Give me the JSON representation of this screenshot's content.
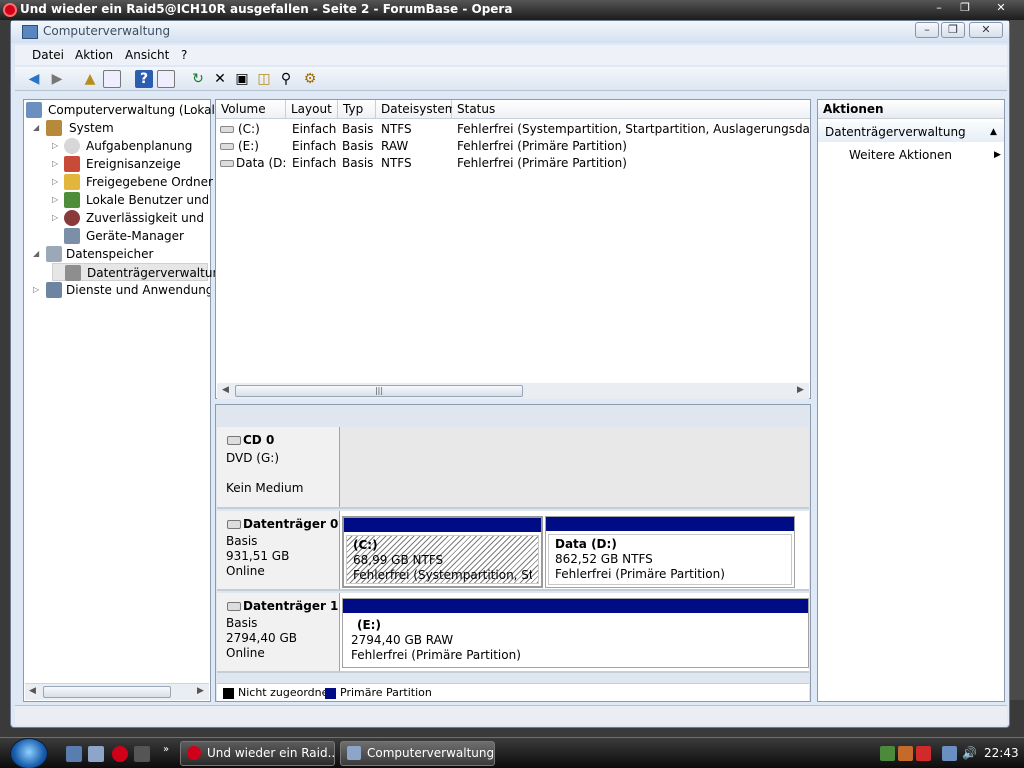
{
  "opera": {
    "title": "Und wieder ein Raid5@ICH10R ausgefallen - Seite 2 - ForumBase - Opera"
  },
  "mmc": {
    "title": "Computerverwaltung",
    "menu": [
      "Datei",
      "Aktion",
      "Ansicht",
      "?"
    ]
  },
  "tree": {
    "root": "Computerverwaltung (Lokal)",
    "system": "System",
    "items": [
      "Aufgabenplanung",
      "Ereignisanzeige",
      "Freigegebene Ordner",
      "Lokale Benutzer und Gruppen",
      "Zuverlässigkeit und Leistung",
      "Geräte-Manager"
    ],
    "storage": "Datenspeicher",
    "disk_mgmt": "Datenträgerverwaltung",
    "services": "Dienste und Anwendungen"
  },
  "list": {
    "columns": [
      "Volume",
      "Layout",
      "Typ",
      "Dateisystem",
      "Status"
    ],
    "rows": [
      [
        "(C:)",
        "Einfach",
        "Basis",
        "NTFS",
        "Fehlerfrei (Systempartition, Startpartition, Auslagerungsdatei, Aktiv, Absturzabbild, Primäre Partition)"
      ],
      [
        "(E:)",
        "Einfach",
        "Basis",
        "RAW",
        "Fehlerfrei (Primäre Partition)"
      ],
      [
        "Data (D:)",
        "Einfach",
        "Basis",
        "NTFS",
        "Fehlerfrei (Primäre Partition)"
      ]
    ]
  },
  "disks": {
    "cd0": {
      "name": "CD 0",
      "type": "DVD (G:)",
      "status": "Kein Medium"
    },
    "disk0": {
      "name": "Datenträger 0",
      "type": "Basis",
      "size": "931,51 GB",
      "state": "Online",
      "p1": {
        "label": "(C:)",
        "size": "68,99 GB NTFS",
        "status": "Fehlerfrei (Systempartition, Startpartition)"
      },
      "p2": {
        "label": "Data  (D:)",
        "size": "862,52 GB NTFS",
        "status": "Fehlerfrei (Primäre Partition)"
      }
    },
    "disk1": {
      "name": "Datenträger 1",
      "type": "Basis",
      "size": "2794,40 GB",
      "state": "Online",
      "p1": {
        "label": "(E:)",
        "size": "2794,40 GB RAW",
        "status": "Fehlerfrei (Primäre Partition)"
      }
    }
  },
  "legend": {
    "unallocated": "Nicht zugeordnet",
    "primary": "Primäre Partition",
    "unallocated_color": "#000000",
    "primary_color": "#000c86"
  },
  "actions": {
    "header": "Aktionen",
    "section": "Datenträgerverwaltung",
    "more": "Weitere Aktionen"
  },
  "taskbar": {
    "task1": "Und wieder ein Raid...",
    "task2": "Computerverwaltung",
    "clock": "22:43"
  }
}
